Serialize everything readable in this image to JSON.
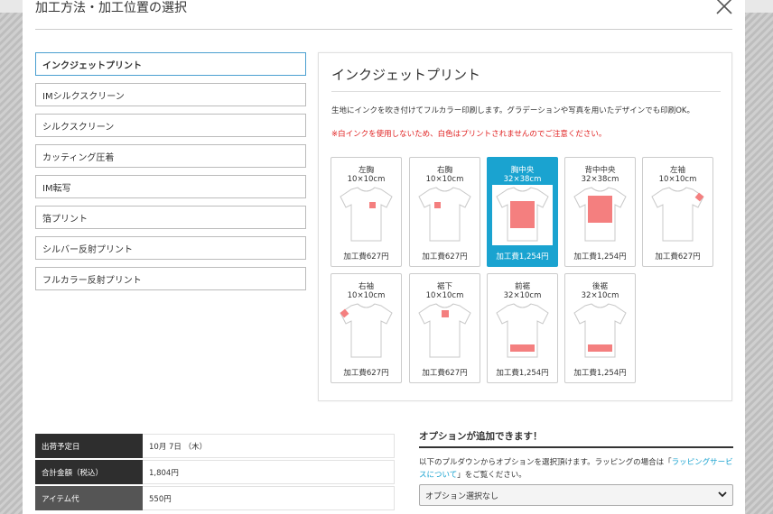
{
  "modal": {
    "title": "加工方法・加工位置の選択"
  },
  "methods": [
    {
      "label": "インクジェットプリント",
      "active": true
    },
    {
      "label": "IMシルクスクリーン",
      "active": false
    },
    {
      "label": "シルクスクリーン",
      "active": false
    },
    {
      "label": "カッティング圧着",
      "active": false
    },
    {
      "label": "IM転写",
      "active": false
    },
    {
      "label": "箔プリント",
      "active": false
    },
    {
      "label": "シルバー反射プリント",
      "active": false
    },
    {
      "label": "フルカラー反射プリント",
      "active": false
    }
  ],
  "panel": {
    "title": "インクジェットプリント",
    "description": "生地にインクを吹き付けてフルカラー印刷します。グラデーションや写真を用いたデザインでも印刷OK。",
    "warning": "※白インクを使用しないため、白色はプリントされませんのでご注意ください。"
  },
  "positions": [
    {
      "name": "左胸",
      "size": "10×10cm",
      "price": "加工費627円",
      "print_area": "left-chest",
      "selected": false
    },
    {
      "name": "右胸",
      "size": "10×10cm",
      "price": "加工費627円",
      "print_area": "right-chest",
      "selected": false
    },
    {
      "name": "胸中央",
      "size": "32×38cm",
      "price": "加工費1,254円",
      "print_area": "chest-center",
      "selected": true
    },
    {
      "name": "背中中央",
      "size": "32×38cm",
      "price": "加工費1,254円",
      "print_area": "back-center",
      "selected": false
    },
    {
      "name": "左袖",
      "size": "10×10cm",
      "price": "加工費627円",
      "print_area": "left-sleeve",
      "selected": false
    },
    {
      "name": "右袖",
      "size": "10×10cm",
      "price": "加工費627円",
      "print_area": "right-sleeve",
      "selected": false
    },
    {
      "name": "裾下",
      "size": "10×10cm",
      "price": "加工費627円",
      "print_area": "hem",
      "selected": false
    },
    {
      "name": "前裾",
      "size": "32×10cm",
      "price": "加工費1,254円",
      "print_area": "front-hem",
      "selected": false
    },
    {
      "name": "後裾",
      "size": "32×10cm",
      "price": "加工費1,254円",
      "print_area": "back-hem",
      "selected": false
    }
  ],
  "summary": {
    "rows": [
      {
        "label": "出荷予定日",
        "value": "10月 7日 （木）"
      },
      {
        "label": "合計金額（税込）",
        "value": "1,804円"
      },
      {
        "label": "アイテム代",
        "value": "550円"
      }
    ]
  },
  "options": {
    "title": "オプションが追加できます！",
    "text_before": "以下のプルダウンからオプションを選択頂けます。ラッピングの場合は「",
    "link_text": "ラッピングサービスについて",
    "text_after": "」をご覧ください。",
    "select_value": "オプション選択なし"
  },
  "colors": {
    "accent": "#1aa3d0",
    "print_area": "#f47f7f",
    "warning": "#e02020",
    "table_header": "#2e2e2e"
  }
}
